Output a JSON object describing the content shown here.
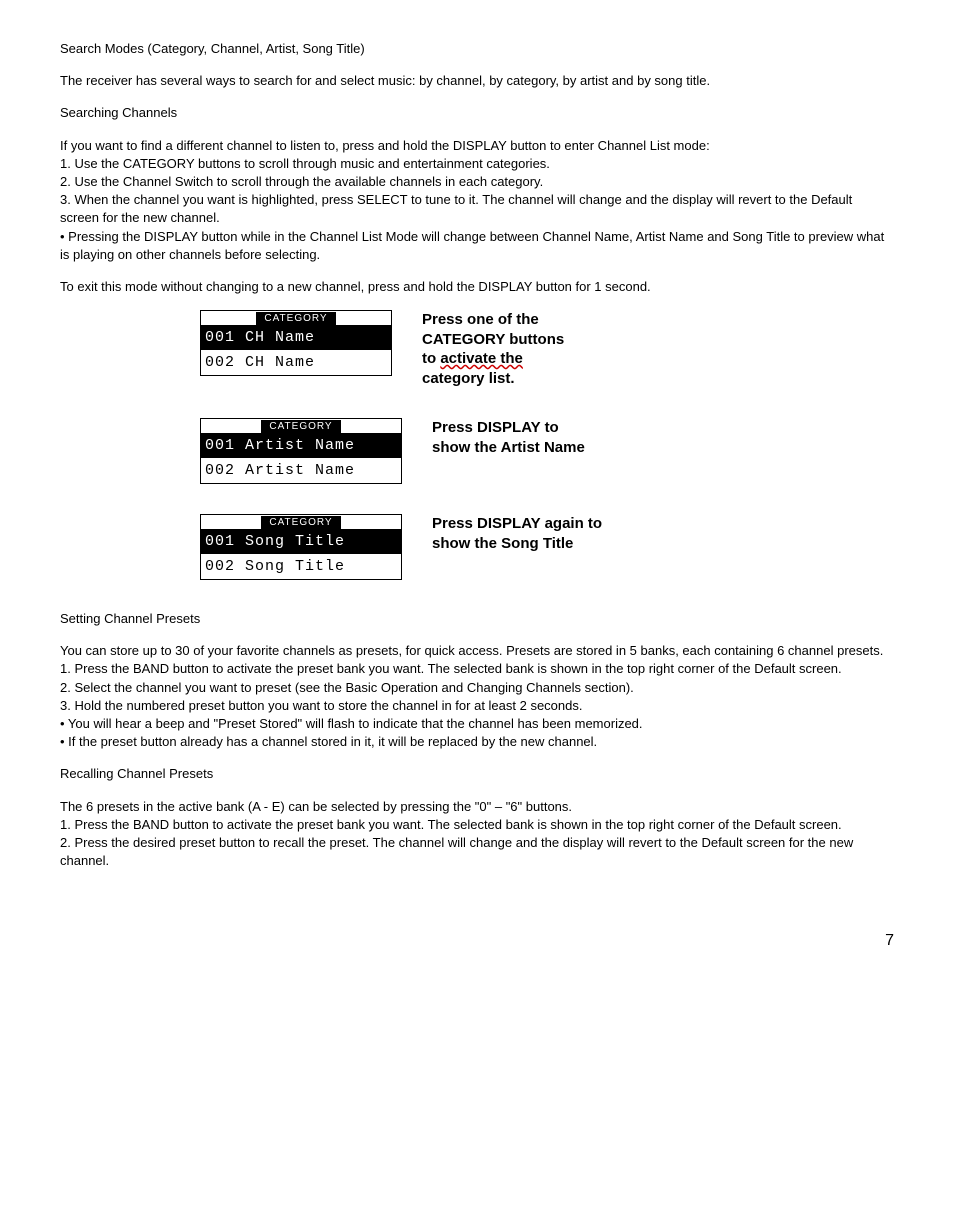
{
  "section1": {
    "heading": "Search Modes (Category, Channel, Artist, Song Title)",
    "intro": "The receiver has several ways to search for and select music: by channel, by category, by artist and by song title."
  },
  "section2": {
    "heading": "Searching Channels",
    "line1": "If you want to find a different channel to listen to, press and hold the DISPLAY button to enter Channel List mode:",
    "line2": "1. Use the CATEGORY buttons to scroll through music and entertainment categories.",
    "line3": "2. Use the Channel Switch to scroll through the available channels in each category.",
    "line4": "3. When the channel you want is highlighted, press SELECT to tune to it.  The channel will change and the display will revert to the Default screen for the new channel.",
    "line5": "•  Pressing the DISPLAY button while in the Channel List Mode will change between Channel Name, Artist Name and Song Title to preview what is playing on other channels before selecting.",
    "line6": "To exit this mode without changing to a new channel, press and hold the DISPLAY button for 1 second."
  },
  "fig1": {
    "tab": "CATEGORY",
    "row1": "001 CH Name",
    "row2": "002 CH Name",
    "caption_l1": "Press one of the",
    "caption_l2": "CATEGORY buttons",
    "caption_l3a": "to ",
    "caption_l3b": "activate  the",
    "caption_l4": "category list."
  },
  "fig2": {
    "tab": "CATEGORY",
    "row1": "001 Artist Name",
    "row2": "002 Artist Name",
    "caption_l1": "Press DISPLAY to",
    "caption_l2": "show the Artist Name"
  },
  "fig3": {
    "tab": "CATEGORY",
    "row1": "001 Song Title",
    "row2": "002 Song Title",
    "caption_l1": "Press DISPLAY again to",
    "caption_l2": "show the Song Title"
  },
  "section3": {
    "heading": "Setting Channel Presets",
    "line1": "You can store up to 30 of your favorite channels as presets, for quick access. Presets are stored in 5 banks, each containing 6 channel presets.",
    "line2": "1. Press the BAND button to activate the preset bank you want. The selected bank is shown in the top right corner of the Default screen.",
    "line3": "2. Select the channel you want to preset (see the Basic Operation and Changing Channels section).",
    "line4": "3. Hold the numbered preset button you want to store the channel in for at least 2 seconds.",
    "line5": "•  You will hear a beep and \"Preset Stored\" will flash to indicate that the channel has been memorized.",
    "line6": "•  If the preset button already has a channel stored in it, it will be replaced by the new channel."
  },
  "section4": {
    "heading": "Recalling Channel Presets",
    "line1": "The 6 presets in the active bank (A - E) can be selected by pressing the \"0\" – \"6\" buttons.",
    "line2": "1. Press the BAND button to activate the preset bank you want. The selected bank is shown in the top right corner of the Default screen.",
    "line3": "2. Press the desired preset button to recall the preset. The channel will change and the display will revert to the Default screen for the new channel."
  },
  "pagenum": "7"
}
